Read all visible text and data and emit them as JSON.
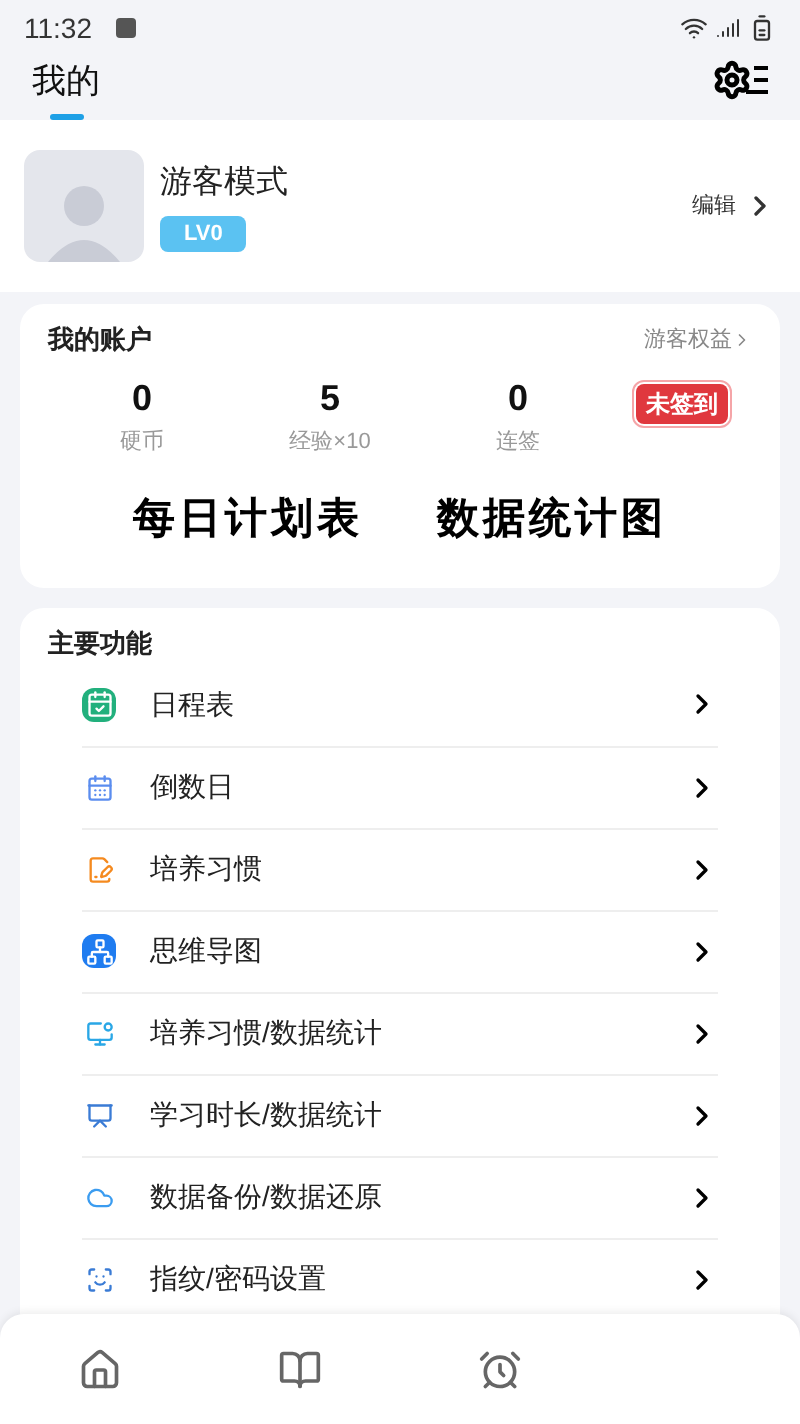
{
  "status_bar": {
    "time": "11:32"
  },
  "header": {
    "tabs": [
      {
        "label": "我的",
        "selected": true
      }
    ]
  },
  "profile": {
    "name": "游客模式",
    "level": "LV0",
    "edit": "编辑"
  },
  "account": {
    "title": "我的账户",
    "link": "游客权益",
    "stats": [
      {
        "value": "0",
        "label": "硬币"
      },
      {
        "value": "5",
        "label": "经验×10"
      },
      {
        "value": "0",
        "label": "连签"
      }
    ],
    "sign_in": "未签到",
    "shortcuts": [
      "每日计划表",
      "数据统计图"
    ]
  },
  "features": {
    "title": "主要功能",
    "items": [
      {
        "label": "日程表"
      },
      {
        "label": "倒数日"
      },
      {
        "label": "培养习惯"
      },
      {
        "label": "思维导图"
      },
      {
        "label": "培养习惯/数据统计"
      },
      {
        "label": "学习时长/数据统计"
      },
      {
        "label": "数据备份/数据还原"
      },
      {
        "label": "指纹/密码设置"
      }
    ]
  }
}
